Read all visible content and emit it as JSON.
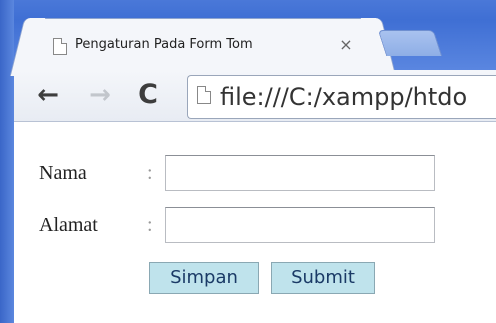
{
  "browser": {
    "tab": {
      "title": "Pengaturan Pada Form Tom",
      "close_glyph": "×",
      "favicon": "page-icon"
    },
    "new_tab_icon": "new-tab-icon",
    "toolbar": {
      "back_glyph": "←",
      "forward_glyph": "→",
      "reload_glyph": "C",
      "address": "file:///C:/xampp/htdo"
    }
  },
  "form": {
    "fields": [
      {
        "label": "Nama",
        "colon": ":",
        "value": ""
      },
      {
        "label": "Alamat",
        "colon": ":",
        "value": ""
      }
    ],
    "buttons": {
      "save": "Simpan",
      "submit": "Submit"
    }
  },
  "colors": {
    "frame": "#4a78d8",
    "button_bg": "#bfe3ec",
    "button_text": "#1a3a66"
  }
}
